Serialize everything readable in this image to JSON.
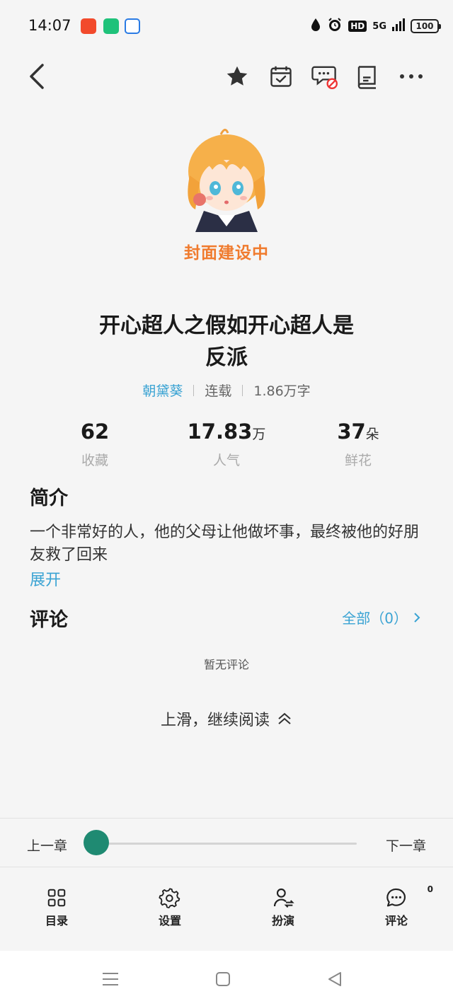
{
  "status_bar": {
    "time": "14:07",
    "network": "5G",
    "hd": "HD",
    "battery": "100"
  },
  "toolbar": {
    "icons": [
      "back-icon",
      "star-icon",
      "calendar-check-icon",
      "comment-off-icon",
      "book-icon",
      "more-icon"
    ]
  },
  "cover": {
    "placeholder_label": "封面建设中"
  },
  "book": {
    "title_line1": "开心超人之假如开心超人是",
    "title_line2": "反派",
    "author": "朝黛葵",
    "status": "连载",
    "word_count": "1.86万字"
  },
  "stats": [
    {
      "value": "62",
      "unit": "",
      "label": "收藏"
    },
    {
      "value": "17.83",
      "unit": "万",
      "label": "人气"
    },
    {
      "value": "37",
      "unit": "朵",
      "label": "鲜花"
    }
  ],
  "intro": {
    "heading": "简介",
    "text": "一个非常好的人，他的父母让他做坏事，最终被他的好朋友救了回来",
    "expand": "展开"
  },
  "comments": {
    "heading": "评论",
    "all_link": "全部（0）",
    "empty_text": "暂无评论"
  },
  "continue_reading": "上滑，继续阅读",
  "chapter_nav": {
    "prev": "上一章",
    "next": "下一章",
    "progress": 0
  },
  "bottom_nav": {
    "items": [
      {
        "label": "目录"
      },
      {
        "label": "设置"
      },
      {
        "label": "扮演"
      },
      {
        "label": "评论",
        "badge": "0"
      }
    ]
  },
  "colors": {
    "accent_blue": "#3aa3d3",
    "slider_green": "#1f8a72",
    "cover_orange": "#f07b2e"
  }
}
